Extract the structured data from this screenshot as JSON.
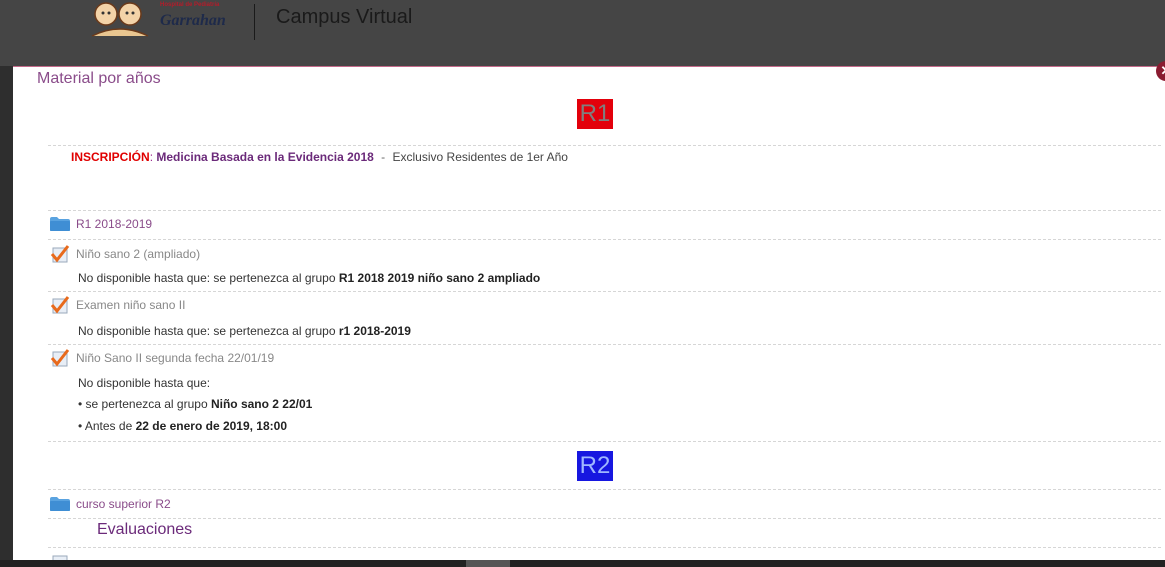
{
  "header": {
    "logo_small": "Hospital de Pediatría",
    "logo_big": "Garrahan",
    "site_title": "Campus Virtual"
  },
  "panel": {
    "title": "Material por años",
    "close_symbol": "✕",
    "badge_r1": "R1",
    "badge_r2": "R2",
    "inscripcion": {
      "label": "INSCRIPCIÓN",
      "colon": ":",
      "course": "Medicina Basada en la Evidencia 2018",
      "separator": "-",
      "note": "Exclusivo Residentes de 1er Año"
    },
    "items": [
      {
        "type": "folder",
        "label": "R1 2018-2019"
      },
      {
        "type": "quiz",
        "label": "Niño sano 2 (ampliado)",
        "restriction_prefix": "No disponible hasta que: se pertenezca al grupo ",
        "restriction_group": "R1 2018 2019 niño sano 2 ampliado"
      },
      {
        "type": "quiz",
        "label": "Examen niño sano II",
        "restriction_prefix": "No disponible hasta que: se pertenezca al grupo ",
        "restriction_group": "r1 2018-2019"
      },
      {
        "type": "quiz",
        "label": "Niño Sano II segunda fecha 22/01/19",
        "restriction_intro": "No disponible hasta que:",
        "bullet1_prefix": "• se pertenezca al grupo ",
        "bullet1_group": "Niño sano 2 22/01",
        "bullet2_prefix": "• Antes de ",
        "bullet2_date": "22 de enero de 2019, 18:00"
      },
      {
        "type": "folder",
        "label": "curso superior R2"
      }
    ],
    "section_heading": "Evaluaciones"
  },
  "icons": {
    "folder": "folder-icon",
    "quiz": "checkbox-check-icon",
    "close": "close-icon"
  },
  "colors": {
    "accent": "#8a4c8a",
    "r1_badge": "#e3000b",
    "r2_badge": "#1717e0",
    "inscripcion": "#e00000"
  }
}
